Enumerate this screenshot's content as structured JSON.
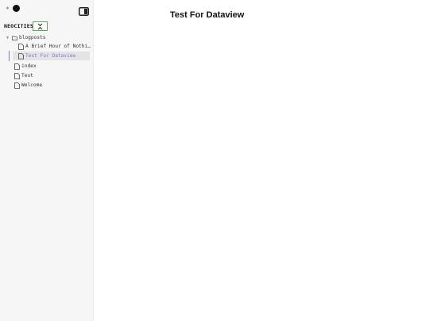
{
  "sidebar": {
    "theme": {
      "light_icon": "sun-icon",
      "dark_icon": "moon-icon"
    },
    "layout_icon": "sidebar-layout-icon",
    "vault_title": "NEOCITIES",
    "collapse_icon": "collapse-all-icon",
    "tree": [
      {
        "type": "folder",
        "label": "blogposts",
        "expanded": true
      },
      {
        "type": "file",
        "label": "A Brief Hour of Nothi…"
      },
      {
        "type": "file",
        "label": "Test For Dataview",
        "active": true
      },
      {
        "type": "file",
        "label": "index"
      },
      {
        "type": "file",
        "label": "Test"
      },
      {
        "type": "file",
        "label": "Welcome"
      }
    ]
  },
  "main": {
    "title": "Test For Dataview"
  },
  "colors": {
    "accent": "#8b6cd8",
    "highlight_border": "#5aab5a",
    "sidebar_bg": "#f6f6f6"
  }
}
